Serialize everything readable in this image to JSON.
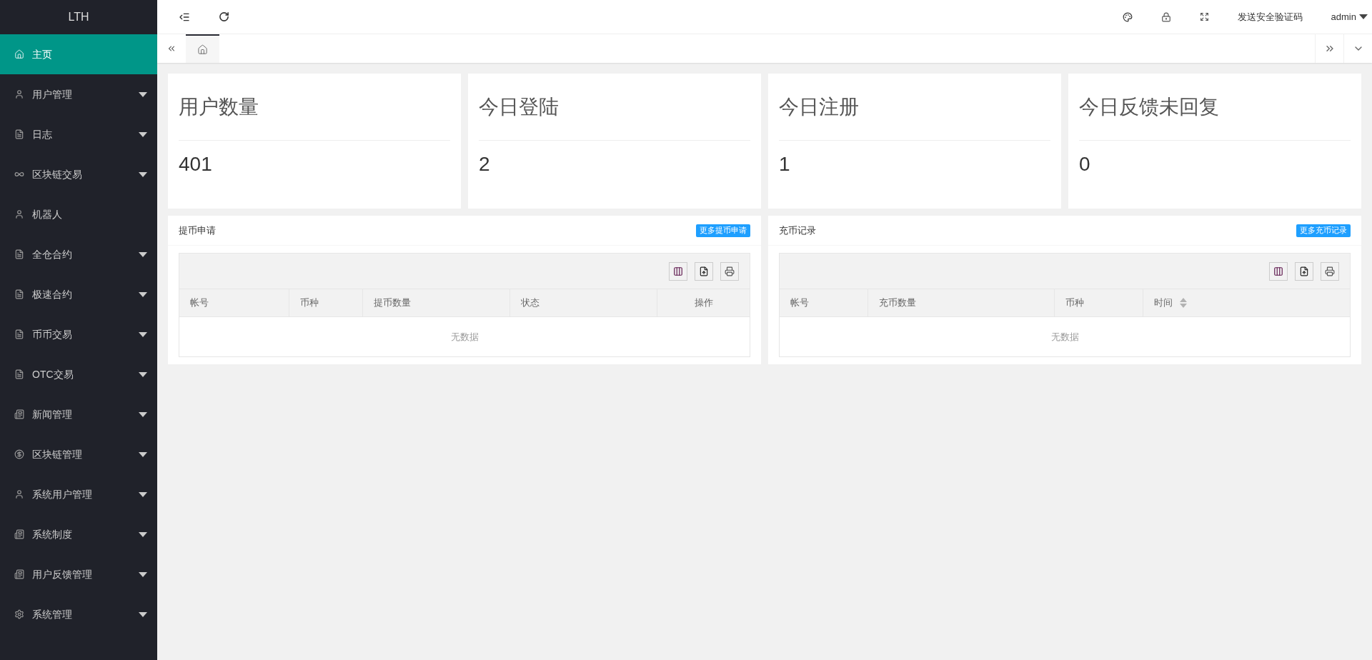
{
  "sidebar": {
    "logo": "LTH",
    "items": [
      {
        "label": "主页",
        "selected": true,
        "expandable": false
      },
      {
        "label": "用户管理",
        "selected": false,
        "expandable": true
      },
      {
        "label": "日志",
        "selected": false,
        "expandable": true
      },
      {
        "label": "区块链交易",
        "selected": false,
        "expandable": true
      },
      {
        "label": "机器人",
        "selected": false,
        "expandable": false
      },
      {
        "label": "全仓合约",
        "selected": false,
        "expandable": true
      },
      {
        "label": "极速合约",
        "selected": false,
        "expandable": true
      },
      {
        "label": "币币交易",
        "selected": false,
        "expandable": true
      },
      {
        "label": "OTC交易",
        "selected": false,
        "expandable": true
      },
      {
        "label": "新闻管理",
        "selected": false,
        "expandable": true
      },
      {
        "label": "区块链管理",
        "selected": false,
        "expandable": true
      },
      {
        "label": "系统用户管理",
        "selected": false,
        "expandable": true
      },
      {
        "label": "系统制度",
        "selected": false,
        "expandable": true
      },
      {
        "label": "用户反馈管理",
        "selected": false,
        "expandable": true
      },
      {
        "label": "系统管理",
        "selected": false,
        "expandable": true
      }
    ]
  },
  "topbar": {
    "send_code": "发送安全验证码",
    "user": "admin"
  },
  "tabs": [
    {
      "selected": true
    }
  ],
  "stats": [
    {
      "title": "用户数量",
      "value": "401"
    },
    {
      "title": "今日登陆",
      "value": "2"
    },
    {
      "title": "今日注册",
      "value": "1"
    },
    {
      "title": "今日反馈未回复",
      "value": "0"
    }
  ],
  "panels": [
    {
      "title": "提币申请",
      "more": "更多提币申请",
      "columns": [
        {
          "label": "帐号",
          "sortable": false
        },
        {
          "label": "币种",
          "sortable": false
        },
        {
          "label": "提币数量",
          "sortable": false
        },
        {
          "label": "状态",
          "sortable": false
        },
        {
          "label": "操作",
          "sortable": false
        }
      ],
      "empty": "无数据"
    },
    {
      "title": "充币记录",
      "more": "更多充币记录",
      "columns": [
        {
          "label": "帐号",
          "sortable": false
        },
        {
          "label": "充币数量",
          "sortable": false
        },
        {
          "label": "币种",
          "sortable": false
        },
        {
          "label": "时间",
          "sortable": true
        }
      ],
      "empty": "无数据"
    }
  ]
}
